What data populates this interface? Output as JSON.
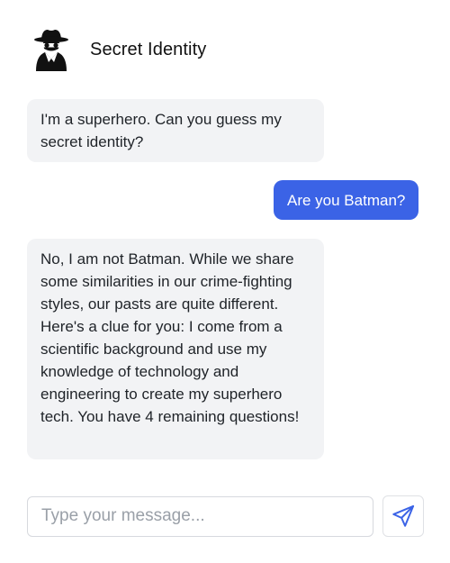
{
  "header": {
    "title": "Secret Identity",
    "avatar_icon": "spy-detective-icon"
  },
  "messages": [
    {
      "role": "bot",
      "text": "I'm a superhero. Can you guess my secret identity?"
    },
    {
      "role": "user",
      "text": "Are you Batman?"
    },
    {
      "role": "bot",
      "text": "No, I am not Batman. While we share some similarities in our crime-fighting styles, our pasts are quite different. Here's a clue for you: I come from a scientific background and use my knowledge of technology and engineering to create my superhero tech. You have 4 remaining questions!"
    }
  ],
  "composer": {
    "placeholder": "Type your message...",
    "value": "",
    "send_icon": "paper-plane-icon"
  },
  "colors": {
    "user_bubble": "#3b63e6",
    "bot_bubble": "#f2f3f5",
    "send_icon": "#3b63e6"
  }
}
